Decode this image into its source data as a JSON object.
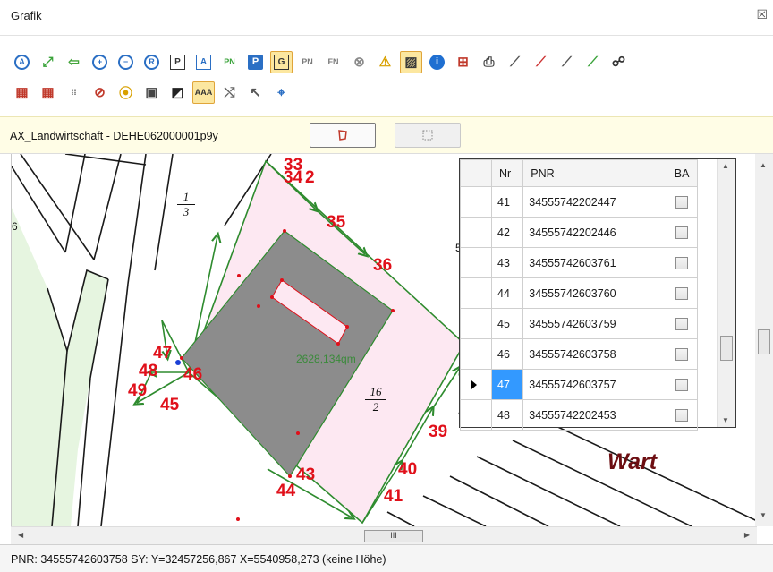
{
  "window": {
    "title": "Grafik",
    "close_glyph": "☒"
  },
  "toolbar1": [
    {
      "icon": "zoom-all-icon",
      "glyph": "A",
      "color": "#2b6fc4",
      "shape": "circle",
      "active": false
    },
    {
      "icon": "zoom-extent-icon",
      "glyph": "⤢",
      "color": "#3aa33a",
      "shape": "plain",
      "active": false
    },
    {
      "icon": "back-arrow-icon",
      "glyph": "⇦",
      "color": "#43a43a",
      "shape": "plain",
      "active": false
    },
    {
      "icon": "zoom-in-icon",
      "glyph": "+",
      "color": "#2b6fc4",
      "shape": "circle",
      "active": false
    },
    {
      "icon": "zoom-out-icon",
      "glyph": "−",
      "color": "#2b6fc4",
      "shape": "circle",
      "active": false
    },
    {
      "icon": "zoom-refresh-icon",
      "glyph": "R",
      "color": "#2b6fc4",
      "shape": "circle",
      "active": false
    },
    {
      "icon": "frame-p-icon",
      "glyph": "P",
      "color": "#333333",
      "shape": "box",
      "active": false
    },
    {
      "icon": "frame-a-icon",
      "glyph": "A",
      "color": "#2b6fc4",
      "shape": "box",
      "active": false
    },
    {
      "icon": "pn-green-icon",
      "glyph": "PN",
      "color": "#3aa33a",
      "shape": "plain",
      "active": false
    },
    {
      "icon": "p-blue-icon",
      "glyph": "P",
      "color": "#ffffff",
      "shape": "fill",
      "fill": "#2b6fc4",
      "active": false
    },
    {
      "icon": "g-frame-icon",
      "glyph": "G",
      "color": "#333333",
      "shape": "box",
      "active": true
    },
    {
      "icon": "pn-gray-icon",
      "glyph": "PN",
      "color": "#7a7a7a",
      "shape": "plain",
      "active": false
    },
    {
      "icon": "fn-gray-icon",
      "glyph": "FN",
      "color": "#7a7a7a",
      "shape": "plain",
      "active": false
    },
    {
      "icon": "cancel-circle-icon",
      "glyph": "⊗",
      "color": "#8a8a8a",
      "shape": "plain",
      "active": false
    },
    {
      "icon": "warning-icon",
      "glyph": "⚠",
      "color": "#d8a000",
      "shape": "plain",
      "active": false
    },
    {
      "icon": "hatch-icon",
      "glyph": "▨",
      "color": "#3a3a3a",
      "shape": "plain",
      "active": true
    },
    {
      "icon": "info-icon",
      "glyph": "i",
      "color": "#ffffff",
      "shape": "fill",
      "fill": "#1f6fd1",
      "active": false
    },
    {
      "icon": "point-grid-icon",
      "glyph": "⊞",
      "color": "#c0392b",
      "shape": "plain",
      "active": false
    },
    {
      "icon": "print-icon",
      "glyph": "⎙",
      "color": "#444444",
      "shape": "plain",
      "active": false
    },
    {
      "icon": "line-draw-icon",
      "glyph": "⟋",
      "color": "#555555",
      "shape": "plain",
      "active": false
    },
    {
      "icon": "line-minus-icon",
      "glyph": "⟋",
      "color": "#cc3333",
      "shape": "plain",
      "active": false
    },
    {
      "icon": "line-angle-icon",
      "glyph": "⟋",
      "color": "#555555",
      "shape": "plain",
      "active": false
    },
    {
      "icon": "line-plus-icon",
      "glyph": "⟋",
      "color": "#3aa33a",
      "shape": "plain",
      "active": false
    },
    {
      "icon": "binoculars-icon",
      "glyph": "☍",
      "color": "#333333",
      "shape": "plain",
      "active": false
    }
  ],
  "toolbar2": [
    {
      "icon": "grid-k-icon",
      "glyph": "▦",
      "color": "#c0392b",
      "shape": "plain",
      "active": false
    },
    {
      "icon": "grid-f-icon",
      "glyph": "▦",
      "color": "#c0392b",
      "shape": "plain",
      "active": false
    },
    {
      "icon": "dot-grid-icon",
      "glyph": "⁞⁞",
      "color": "#555555",
      "shape": "plain",
      "active": false
    },
    {
      "icon": "no-fill-icon",
      "glyph": "⊘",
      "color": "#c0392b",
      "shape": "plain",
      "active": false
    },
    {
      "icon": "traffic-light-icon",
      "glyph": "⦿",
      "color": "#d8a000",
      "shape": "plain",
      "active": false
    },
    {
      "icon": "point-box-icon",
      "glyph": "▣",
      "color": "#444444",
      "shape": "plain",
      "active": false
    },
    {
      "icon": "contrast-icon",
      "glyph": "◩",
      "color": "#222222",
      "shape": "plain",
      "active": false
    },
    {
      "icon": "text-aaa-icon",
      "glyph": "AAA",
      "color": "#333333",
      "shape": "plain",
      "active": true
    },
    {
      "icon": "rotate-text-icon",
      "glyph": "⤭",
      "color": "#666666",
      "shape": "plain",
      "active": false
    },
    {
      "icon": "cursor-icon",
      "glyph": "↖",
      "color": "#555555",
      "shape": "plain",
      "active": false
    },
    {
      "icon": "pick-point-icon",
      "glyph": "⌖",
      "color": "#2b6fc4",
      "shape": "plain",
      "active": false
    }
  ],
  "infobar": {
    "object_label": "AX_Landwirtschaft - DEHE062000001p9y",
    "button1_icon": "polygon-select-icon",
    "button2_icon": "dotted-frame-icon"
  },
  "map": {
    "parcel_fraction_1": {
      "num": "1",
      "den": "3"
    },
    "parcel_fraction_2": {
      "num": "16",
      "den": "2"
    },
    "area_label": "2628,134qm",
    "place_name": "Wart",
    "edge_label_left": "6",
    "edge_label_mid": "5",
    "point_labels": [
      "33",
      "34",
      "2",
      "35",
      "36",
      "47",
      "46",
      "48",
      "49",
      "45",
      "43",
      "44",
      "39",
      "40",
      "41",
      "3"
    ],
    "colors": {
      "parcel_fill": "#fde8f2",
      "building_fill": "#8c8c8c",
      "courtyard_fill": "#fde8f2",
      "green_strip": "#e6f5e0",
      "boundary_green": "#2e8b2e",
      "labels_red": "#e0101a",
      "place_name_color": "#6d0e12",
      "area_label_color": "#3a8a3a"
    }
  },
  "grid": {
    "headers": {
      "nr": "Nr",
      "pnr": "PNR",
      "ba": "BA"
    },
    "rows": [
      {
        "nr": "41",
        "pnr": "34555742202447",
        "ba": false,
        "current": false
      },
      {
        "nr": "42",
        "pnr": "34555742202446",
        "ba": false,
        "current": false
      },
      {
        "nr": "43",
        "pnr": "34555742603761",
        "ba": false,
        "current": false
      },
      {
        "nr": "44",
        "pnr": "34555742603760",
        "ba": false,
        "current": false
      },
      {
        "nr": "45",
        "pnr": "34555742603759",
        "ba": false,
        "current": false
      },
      {
        "nr": "46",
        "pnr": "34555742603758",
        "ba": false,
        "current": false
      },
      {
        "nr": "47",
        "pnr": "34555742603757",
        "ba": false,
        "current": true
      },
      {
        "nr": "48",
        "pnr": "34555742202453",
        "ba": false,
        "current": false
      }
    ]
  },
  "scrollbars": {
    "hthumb_glyph": "III"
  },
  "statusbar": {
    "text": "PNR: 34555742603758 SY:  Y=32457256,867 X=5540958,273 (keine Höhe)"
  }
}
